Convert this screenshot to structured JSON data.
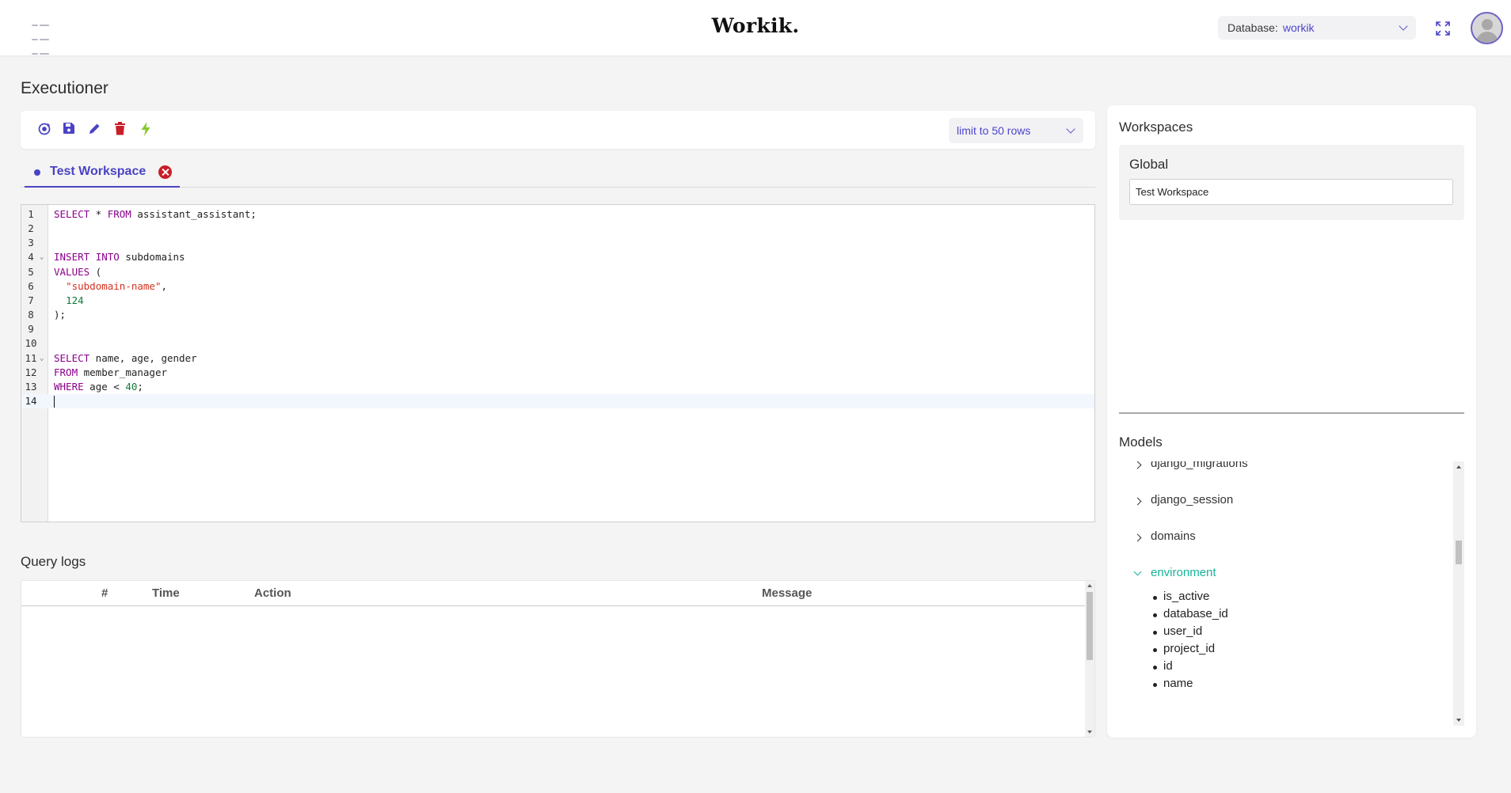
{
  "header": {
    "logo": "Workik.",
    "database_label": "Database:",
    "database_value": "workik"
  },
  "page": {
    "title": "Executioner"
  },
  "toolbar": {
    "icons": [
      "refresh-icon",
      "save-icon",
      "edit-icon",
      "delete-icon",
      "execute-icon"
    ],
    "limit_label": "limit to 50 rows"
  },
  "tabs": [
    {
      "label": "Test Workspace",
      "active": true
    }
  ],
  "editor": {
    "active_line": 14,
    "lines": [
      {
        "n": "1",
        "code": "SELECT * FROM assistant_assistant;"
      },
      {
        "n": "2",
        "code": ""
      },
      {
        "n": "3",
        "code": ""
      },
      {
        "n": "4",
        "code": "INSERT INTO subdomains",
        "fold": true
      },
      {
        "n": "5",
        "code": "VALUES ("
      },
      {
        "n": "6",
        "code": "  \"subdomain-name\","
      },
      {
        "n": "7",
        "code": "  124"
      },
      {
        "n": "8",
        "code": ");"
      },
      {
        "n": "9",
        "code": ""
      },
      {
        "n": "10",
        "code": ""
      },
      {
        "n": "11",
        "code": "SELECT name, age, gender",
        "fold": true
      },
      {
        "n": "12",
        "code": "FROM member_manager"
      },
      {
        "n": "13",
        "code": "WHERE age < 40;"
      },
      {
        "n": "14",
        "code": ""
      }
    ]
  },
  "query_logs": {
    "title": "Query logs",
    "columns": [
      "#",
      "Time",
      "Action",
      "Message"
    ],
    "rows": []
  },
  "workspaces": {
    "title": "Workspaces",
    "global_label": "Global",
    "global_value": "Test Workspace"
  },
  "models": {
    "title": "Models",
    "items": [
      {
        "name": "django_migrations",
        "open": false
      },
      {
        "name": "django_session",
        "open": false
      },
      {
        "name": "domains",
        "open": false
      },
      {
        "name": "environment",
        "open": true,
        "fields": [
          "is_active",
          "database_id",
          "user_id",
          "project_id",
          "id",
          "name"
        ]
      }
    ]
  },
  "colors": {
    "accent": "#4a43c4",
    "keyword": "#8b008b",
    "string": "#d5301f",
    "number": "#117a3a",
    "danger": "#c81e28",
    "expanded_model": "#19b39a"
  }
}
